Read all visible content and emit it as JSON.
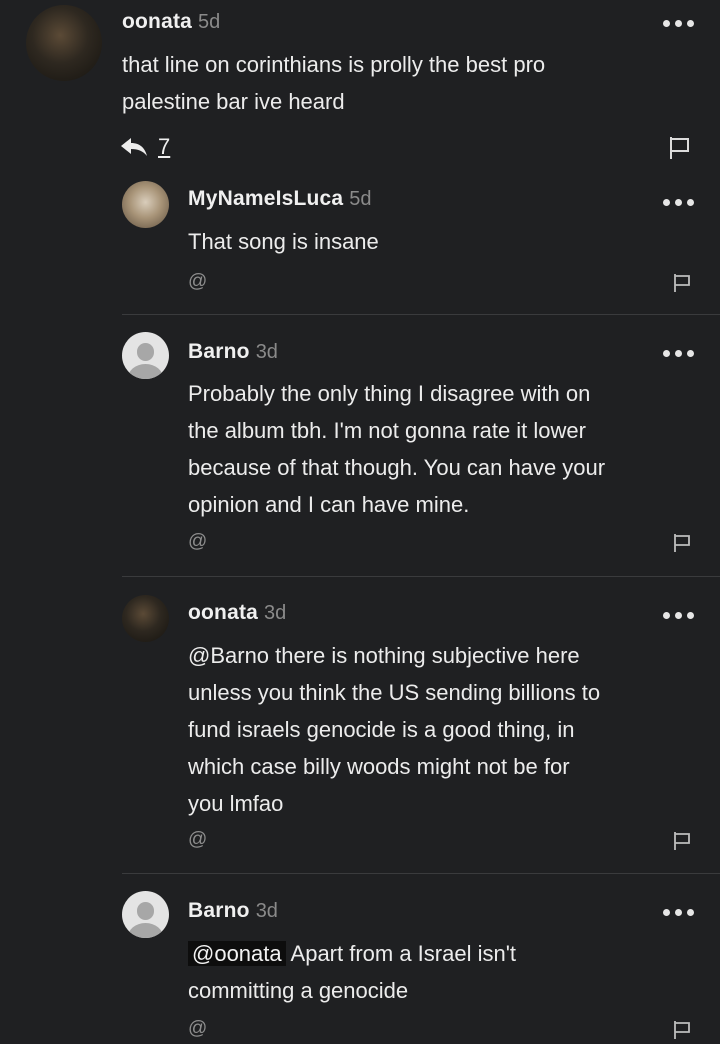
{
  "comments": [
    {
      "user": "oonata",
      "age": "5d",
      "lines": [
        "that line on corinthians is prolly the best pro",
        "palestine bar ive heard"
      ],
      "reply_count": "7",
      "avatar": "dark-photo"
    },
    {
      "user": "MyNameIsLuca",
      "age": "5d",
      "lines": [
        "That song is insane"
      ],
      "reply_label": "@",
      "avatar": "dog-photo"
    },
    {
      "user": "Barno",
      "age": "3d",
      "lines": [
        "Probably the only thing I disagree with on",
        "the album tbh. I'm not gonna rate it lower",
        "because of that though. You can have your",
        "opinion and I can have mine."
      ],
      "reply_label": "@",
      "avatar": "default"
    },
    {
      "user": "oonata",
      "age": "3d",
      "lines": [
        "@Barno there is nothing subjective here",
        "unless you think the US sending billions to",
        "fund israels genocide is a good thing, in",
        "which case billy woods might not be for",
        "you lmfao"
      ],
      "reply_label": "@",
      "avatar": "dark-photo"
    },
    {
      "user": "Barno",
      "age": "3d",
      "mention": "@oonata",
      "lines": [
        "Apart from a Israel isn't",
        "committing a genocide"
      ],
      "reply_label": "@",
      "avatar": "default"
    }
  ],
  "icons": {
    "reply": "reply-arrow-icon",
    "more": "more-options-icon",
    "flag": "flag-icon",
    "mention": "at-mention-icon"
  },
  "colors": {
    "background": "#1f2022",
    "text": "#ececec",
    "muted": "#8a8a8a",
    "divider": "#3a3b3d"
  }
}
